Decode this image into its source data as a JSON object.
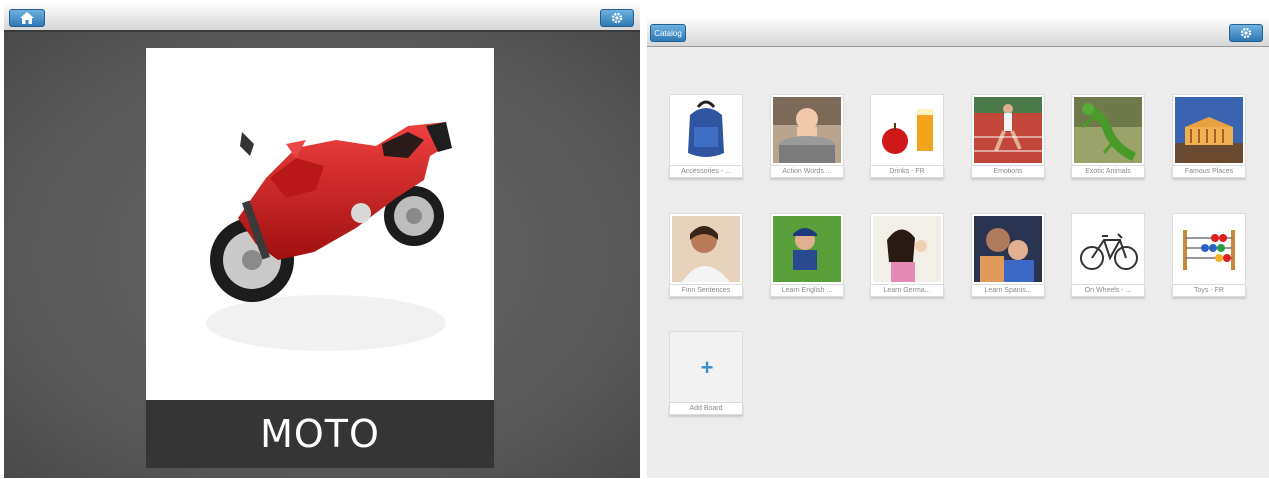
{
  "left_screen": {
    "home_icon": "home-icon",
    "settings_icon": "gear-icon",
    "card": {
      "label": "MOTO",
      "image": "red-motorcycle"
    }
  },
  "right_screen": {
    "catalog_label": "Catalog",
    "settings_icon": "gear-icon",
    "boards": [
      {
        "label": "Accessories - ...",
        "image": "backpack"
      },
      {
        "label": "Action Words ...",
        "image": "baby-in-bucket"
      },
      {
        "label": "Drinks - FR",
        "image": "apple-and-juice"
      },
      {
        "label": "Emotions",
        "image": "runner-on-track"
      },
      {
        "label": "Exotic Animals",
        "image": "green-lizard"
      },
      {
        "label": "Famous Places",
        "image": "lit-up-monument"
      },
      {
        "label": "Finn Sentences",
        "image": "smiling-woman"
      },
      {
        "label": "Learn English ...",
        "image": "boy-in-grass"
      },
      {
        "label": "Learn Germa...",
        "image": "girl-eating"
      },
      {
        "label": "Learn Spanis...",
        "image": "mother-and-child"
      },
      {
        "label": "On Wheels - ...",
        "image": "bicycle"
      },
      {
        "label": "Toys - FR",
        "image": "abacus"
      }
    ],
    "add_board": {
      "symbol": "+",
      "label": "Add Board"
    }
  },
  "colors": {
    "button_blue": "#3d8cc8",
    "label_bar": "#353535",
    "motorcycle_red": "#d42020"
  }
}
